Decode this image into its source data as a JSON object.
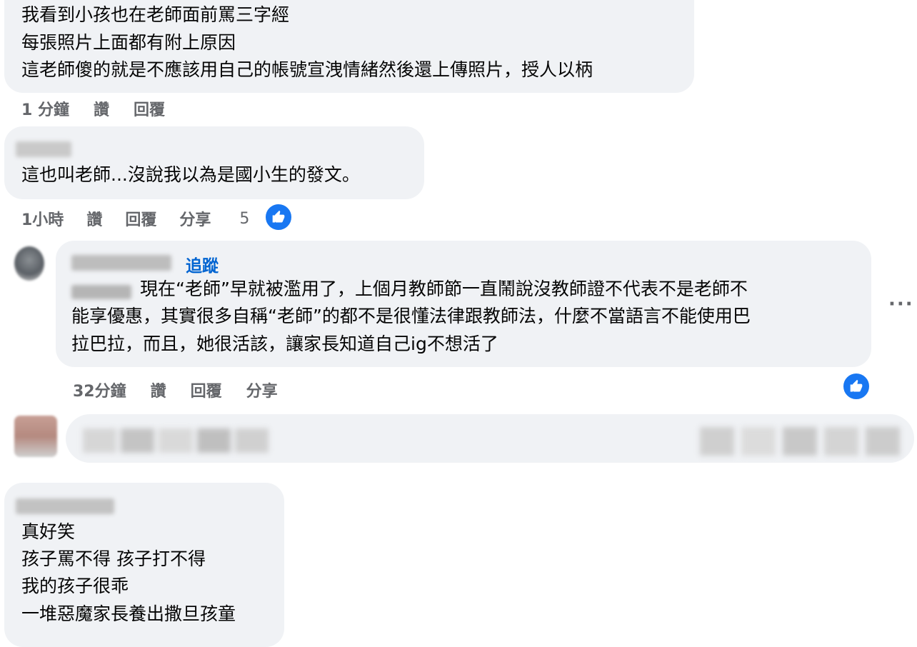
{
  "comments": [
    {
      "lines": [
        "我看到小孩也在老師面前罵三字經",
        "每張照片上面都有附上原因",
        "這老師傻的就是不應該用自己的帳號宣洩情緒然後還上傳照片，授人以柄"
      ],
      "time": "1 分鐘",
      "like_label": "讚",
      "reply_label": "回覆"
    },
    {
      "text": "這也叫老師...沒說我以為是國小生的發文。",
      "time": "1小時",
      "like_label": "讚",
      "reply_label": "回覆",
      "share_label": "分享",
      "reaction_count": "5"
    },
    {
      "follow_label": "追蹤",
      "lines": [
        "現在“老師”早就被濫用了，上個月教師節一直鬧說沒教師證不代表不是老師不",
        "能享優惠，其實很多自稱“老師”的都不是很懂法律跟教師法，什麼不當語言不能使用巴",
        "拉巴拉，而且，她很活該，讓家長知道自己ig不想活了"
      ],
      "time": "32分鐘",
      "like_label": "讚",
      "reply_label": "回覆",
      "share_label": "分享",
      "more_label": "···"
    },
    {
      "lines": [
        "真好笑",
        "孩子罵不得 孩子打不得",
        "我的孩子很乖",
        "一堆惡魔家長養出撒旦孩童"
      ]
    }
  ],
  "icons": {
    "like": "thumbs-up-icon",
    "more": "more-horizontal-icon"
  },
  "colors": {
    "bubble": "#f0f2f5",
    "like_blue": "#1877f2",
    "follow_blue": "#0064d1",
    "meta_gray": "#65676b"
  }
}
